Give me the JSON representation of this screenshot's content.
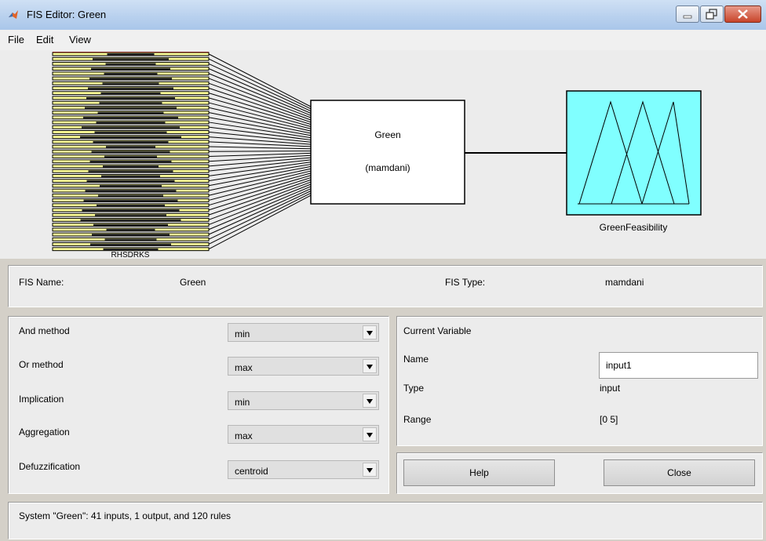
{
  "window": {
    "title": "FIS Editor: Green",
    "controls": [
      "minimize-icon",
      "maximize-icon",
      "close-icon"
    ]
  },
  "menu": {
    "file": "File",
    "edit": "Edit",
    "view": "View"
  },
  "diagram": {
    "inputs_label": "RHSDRKS",
    "system_name": "Green",
    "system_type": "(mamdani)",
    "output_name": "GreenFeasibility",
    "output_color": "#80ffff",
    "input_color": "#ffff99",
    "input_count": 41
  },
  "fis": {
    "name_label": "FIS Name:",
    "name_value": "Green",
    "type_label": "FIS Type:",
    "type_value": "mamdani"
  },
  "methods": {
    "and_label": "And method",
    "and_value": "min",
    "or_label": "Or method",
    "or_value": "max",
    "imp_label": "Implication",
    "imp_value": "min",
    "agg_label": "Aggregation",
    "agg_value": "max",
    "defuzz_label": "Defuzzification",
    "defuzz_value": "centroid"
  },
  "current_variable": {
    "heading": "Current Variable",
    "name_label": "Name",
    "name_value": "input1",
    "type_label": "Type",
    "type_value": "input",
    "range_label": "Range",
    "range_value": "[0 5]"
  },
  "buttons": {
    "help": "Help",
    "close": "Close"
  },
  "status": "System \"Green\": 41 inputs, 1 output, and 120 rules"
}
